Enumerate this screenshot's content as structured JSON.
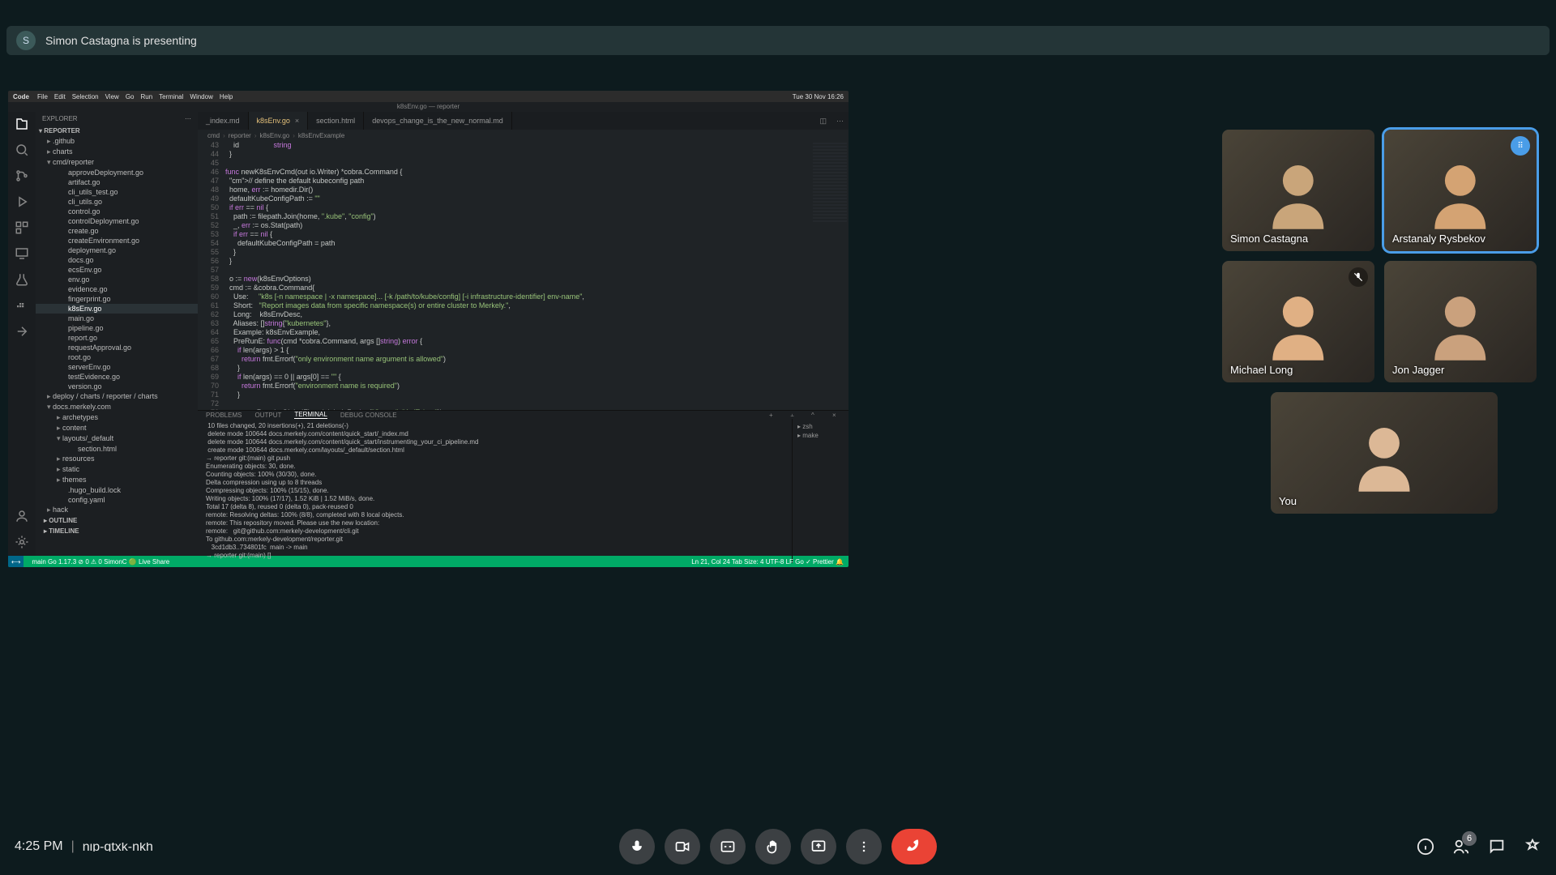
{
  "banner": {
    "avatar_initial": "S",
    "text": "Simon Castagna is presenting"
  },
  "mac_menu": {
    "app": "Code",
    "items": [
      "File",
      "Edit",
      "Selection",
      "View",
      "Go",
      "Run",
      "Terminal",
      "Window",
      "Help"
    ],
    "clock": "Tue 30 Nov 16:26"
  },
  "window_title": "k8sEnv.go — reporter",
  "explorer": {
    "title": "EXPLORER",
    "root": "REPORTER",
    "tree": [
      {
        "type": "folder",
        "name": ".github"
      },
      {
        "type": "folder",
        "name": "charts"
      },
      {
        "type": "folder-open",
        "name": "cmd/reporter"
      },
      {
        "type": "go",
        "name": "approveDeployment.go",
        "nest": 1
      },
      {
        "type": "go",
        "name": "artifact.go",
        "nest": 1
      },
      {
        "type": "go",
        "name": "cli_utils_test.go",
        "nest": 1
      },
      {
        "type": "go",
        "name": "cli_utils.go",
        "nest": 1
      },
      {
        "type": "go",
        "name": "control.go",
        "nest": 1
      },
      {
        "type": "go",
        "name": "controlDeployment.go",
        "nest": 1
      },
      {
        "type": "go",
        "name": "create.go",
        "nest": 1
      },
      {
        "type": "go",
        "name": "createEnvironment.go",
        "nest": 1
      },
      {
        "type": "go",
        "name": "deployment.go",
        "nest": 1
      },
      {
        "type": "go",
        "name": "docs.go",
        "nest": 1
      },
      {
        "type": "go",
        "name": "ecsEnv.go",
        "nest": 1
      },
      {
        "type": "go",
        "name": "env.go",
        "nest": 1
      },
      {
        "type": "go",
        "name": "evidence.go",
        "nest": 1
      },
      {
        "type": "go",
        "name": "fingerprint.go",
        "nest": 1
      },
      {
        "type": "go",
        "name": "k8sEnv.go",
        "nest": 1,
        "active": true
      },
      {
        "type": "go",
        "name": "main.go",
        "nest": 1
      },
      {
        "type": "go",
        "name": "pipeline.go",
        "nest": 1
      },
      {
        "type": "go",
        "name": "report.go",
        "nest": 1
      },
      {
        "type": "go",
        "name": "requestApproval.go",
        "nest": 1
      },
      {
        "type": "go",
        "name": "root.go",
        "nest": 1
      },
      {
        "type": "go",
        "name": "serverEnv.go",
        "nest": 1
      },
      {
        "type": "go",
        "name": "testEvidence.go",
        "nest": 1
      },
      {
        "type": "go",
        "name": "version.go",
        "nest": 1
      },
      {
        "type": "folder",
        "name": "deploy / charts / reporter / charts"
      },
      {
        "type": "folder-open",
        "name": "docs.merkely.com"
      },
      {
        "type": "folder",
        "name": "archetypes",
        "nest": 1
      },
      {
        "type": "folder",
        "name": "content",
        "nest": 1
      },
      {
        "type": "folder-open",
        "name": "layouts/_default",
        "nest": 1
      },
      {
        "type": "file",
        "name": "section.html",
        "nest": 2
      },
      {
        "type": "folder",
        "name": "resources",
        "nest": 1
      },
      {
        "type": "folder",
        "name": "static",
        "nest": 1
      },
      {
        "type": "folder",
        "name": "themes",
        "nest": 1
      },
      {
        "type": "file",
        "name": ".hugo_build.lock",
        "nest": 1
      },
      {
        "type": "file",
        "name": "config.yaml",
        "nest": 1
      },
      {
        "type": "folder",
        "name": "hack"
      }
    ],
    "outline": "OUTLINE",
    "timeline": "TIMELINE"
  },
  "tabs": [
    {
      "label": "_index.md",
      "active": false
    },
    {
      "label": "k8sEnv.go",
      "active": true,
      "closable": true
    },
    {
      "label": "section.html",
      "active": false
    },
    {
      "label": "devops_change_is_the_new_normal.md",
      "active": false
    }
  ],
  "breadcrumbs": [
    "cmd",
    "reporter",
    "k8sEnv.go",
    "k8sEnvExample"
  ],
  "code_start_line": 43,
  "code": "    id                 string\n  }\n\nfunc newK8sEnvCmd(out io.Writer) *cobra.Command {\n  // define the default kubeconfig path\n  home, err := homedir.Dir()\n  defaultKubeConfigPath := \"\"\n  if err == nil {\n    path := filepath.Join(home, \".kube\", \"config\")\n    _, err := os.Stat(path)\n    if err == nil {\n      defaultKubeConfigPath = path\n    }\n  }\n\n  o := new(k8sEnvOptions)\n  cmd := &cobra.Command{\n    Use:     \"k8s [-n namespace | -x namespace]... [-k /path/to/kube/config] [-i infrastructure-identifier] env-name\",\n    Short:   \"Report images data from specific namespace(s) or entire cluster to Merkely.\",\n    Long:    k8sEnvDesc,\n    Aliases: []string{\"kubernetes\"},\n    Example: k8sEnvExample,\n    PreRunE: func(cmd *cobra.Command, args []string) error {\n      if len(args) > 1 {\n        return fmt.Errorf(\"only environment name argument is allowed\")\n      }\n      if len(args) == 0 || args[0] == \"\" {\n        return fmt.Errorf(\"environment name is required\")\n      }\n\n      err := RequireGlobalFlags(global, []string{\"Owner\", \"ApiToken\"})\n      if err != nil {\n        return err",
  "panel": {
    "tabs": [
      "PROBLEMS",
      "OUTPUT",
      "TERMINAL",
      "DEBUG CONSOLE"
    ],
    "active": "TERMINAL",
    "shells": [
      "zsh",
      "make"
    ],
    "terminal": " 10 files changed, 20 insertions(+), 21 deletions(-)\n delete mode 100644 docs.merkely.com/content/quick_start/_index.md\n delete mode 100644 docs.merkely.com/content/quick_start/instrumenting_your_ci_pipeline.md\n create mode 100644 docs.merkely.com/layouts/_default/section.html\n→ reporter git:(main) git push\nEnumerating objects: 30, done.\nCounting objects: 100% (30/30), done.\nDelta compression using up to 8 threads\nCompressing objects: 100% (15/15), done.\nWriting objects: 100% (17/17), 1.52 KiB | 1.52 MiB/s, done.\nTotal 17 (delta 8), reused 0 (delta 0), pack-reused 0\nremote: Resolving deltas: 100% (8/8), completed with 8 local objects.\nremote: This repository moved. Please use the new location:\nremote:   git@github.com:merkely-development/cli.git\nTo github.com:merkely-development/reporter.git\n   3cd1db3..734801fc  main -> main\n→ reporter git:(main) []"
  },
  "statusbar": {
    "left": [
      "main",
      "Go 1.17.3",
      "⊘ 0 ⚠ 0",
      "SimonC 🟢",
      "Live Share"
    ],
    "right": [
      "Ln 21, Col 24",
      "Tab Size: 4",
      "UTF-8",
      "LF",
      "Go",
      "✓ Prettier",
      "🔔"
    ]
  },
  "participants": [
    {
      "name": "Simon Castagna",
      "speaking": false,
      "muted": false
    },
    {
      "name": "Arstanaly Rysbekov",
      "speaking": true,
      "muted": false
    },
    {
      "name": "Michael Long",
      "speaking": false,
      "muted": true
    },
    {
      "name": "Jon Jagger",
      "speaking": false,
      "muted": false
    },
    {
      "name": "You",
      "speaking": false,
      "muted": false,
      "you": true
    }
  ],
  "bottom": {
    "time": "4:25 PM",
    "meeting_code": "nip-qtxk-nkh",
    "people_count": "6"
  }
}
